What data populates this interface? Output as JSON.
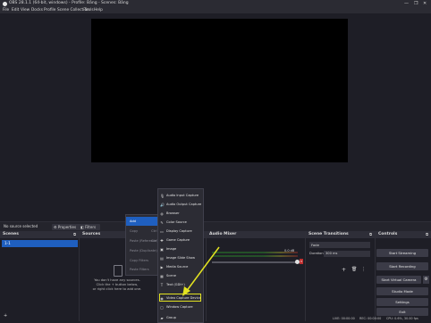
{
  "titlebar": {
    "title": "OBS 28.1.1 (64-bit, windows) - Profile: Bảng - Scenes: Bảng",
    "minimize": "—",
    "maximize": "❐",
    "close": "✕"
  },
  "menubar": {
    "items": [
      "File",
      "Edit",
      "View",
      "Docks",
      "Profile",
      "Scene Collection",
      "Tools",
      "Help"
    ]
  },
  "source_bar": {
    "no_source": "No source selected",
    "properties": "Properties",
    "filters": "Filters"
  },
  "docks": {
    "scenes": {
      "title": "Scenes",
      "items": [
        "1-1"
      ]
    },
    "sources": {
      "title": "Sources",
      "empty_line1": "You don't have any sources.",
      "empty_line2": "Click the + button below,",
      "empty_line3": "or right click here to add one."
    },
    "mixer": {
      "title": "Audio Mixer",
      "level": "0.0 dB"
    },
    "transitions": {
      "title": "Scene Transitions",
      "type": "Fade",
      "duration_label": "Duration",
      "duration": "300 ms"
    },
    "controls": {
      "title": "Controls",
      "buttons": [
        "Start Streaming",
        "Start Recording",
        "Start Virtual Camera",
        "Studio Mode",
        "Settings",
        "Exit"
      ]
    }
  },
  "context_menu": {
    "items": [
      {
        "label": "Add",
        "active": true
      },
      {
        "label": "Copy",
        "shortcut": "Ctrl+C"
      },
      {
        "label": "Paste (Reference)",
        "shortcut": "Ctrl+V"
      },
      {
        "label": "Paste (Duplicate)"
      },
      {
        "label": "Copy Filters"
      },
      {
        "label": "Paste Filters"
      }
    ]
  },
  "add_submenu": {
    "items": [
      {
        "label": "Audio Input Capture",
        "icon": "microphone-icon",
        "glyph": "🎙"
      },
      {
        "label": "Audio Output Capture",
        "icon": "speaker-icon",
        "glyph": "🔊"
      },
      {
        "label": "Browser",
        "icon": "globe-icon",
        "glyph": "◍"
      },
      {
        "label": "Color Source",
        "icon": "brush-icon",
        "glyph": "✎"
      },
      {
        "label": "Display Capture",
        "icon": "monitor-icon",
        "glyph": "▭"
      },
      {
        "label": "Game Capture",
        "icon": "gamepad-icon",
        "glyph": "✚"
      },
      {
        "label": "Image",
        "icon": "image-icon",
        "glyph": "▣"
      },
      {
        "label": "Image Slide Show",
        "icon": "slideshow-icon",
        "glyph": "▤"
      },
      {
        "label": "Media Source",
        "icon": "play-icon",
        "glyph": "▶"
      },
      {
        "label": "Scene",
        "icon": "scene-icon",
        "glyph": "▦"
      },
      {
        "label": "Text (GDI+)",
        "icon": "text-icon",
        "glyph": "T"
      },
      {
        "label": "Video Capture Device",
        "icon": "camera-icon",
        "glyph": "◉",
        "highlighted": true
      },
      {
        "label": "Window Capture",
        "icon": "window-icon",
        "glyph": "▢"
      },
      {
        "label": "Group",
        "icon": "folder-icon",
        "glyph": "▰"
      }
    ]
  },
  "statusbar": {
    "live": "LIVE: 00:00:00",
    "rec": "REC: 00:00:00",
    "cpu": "CPU: 0.6%, 30.00 fps"
  },
  "colors": {
    "accent": "#1f5fbf",
    "highlight": "#e3e321"
  }
}
